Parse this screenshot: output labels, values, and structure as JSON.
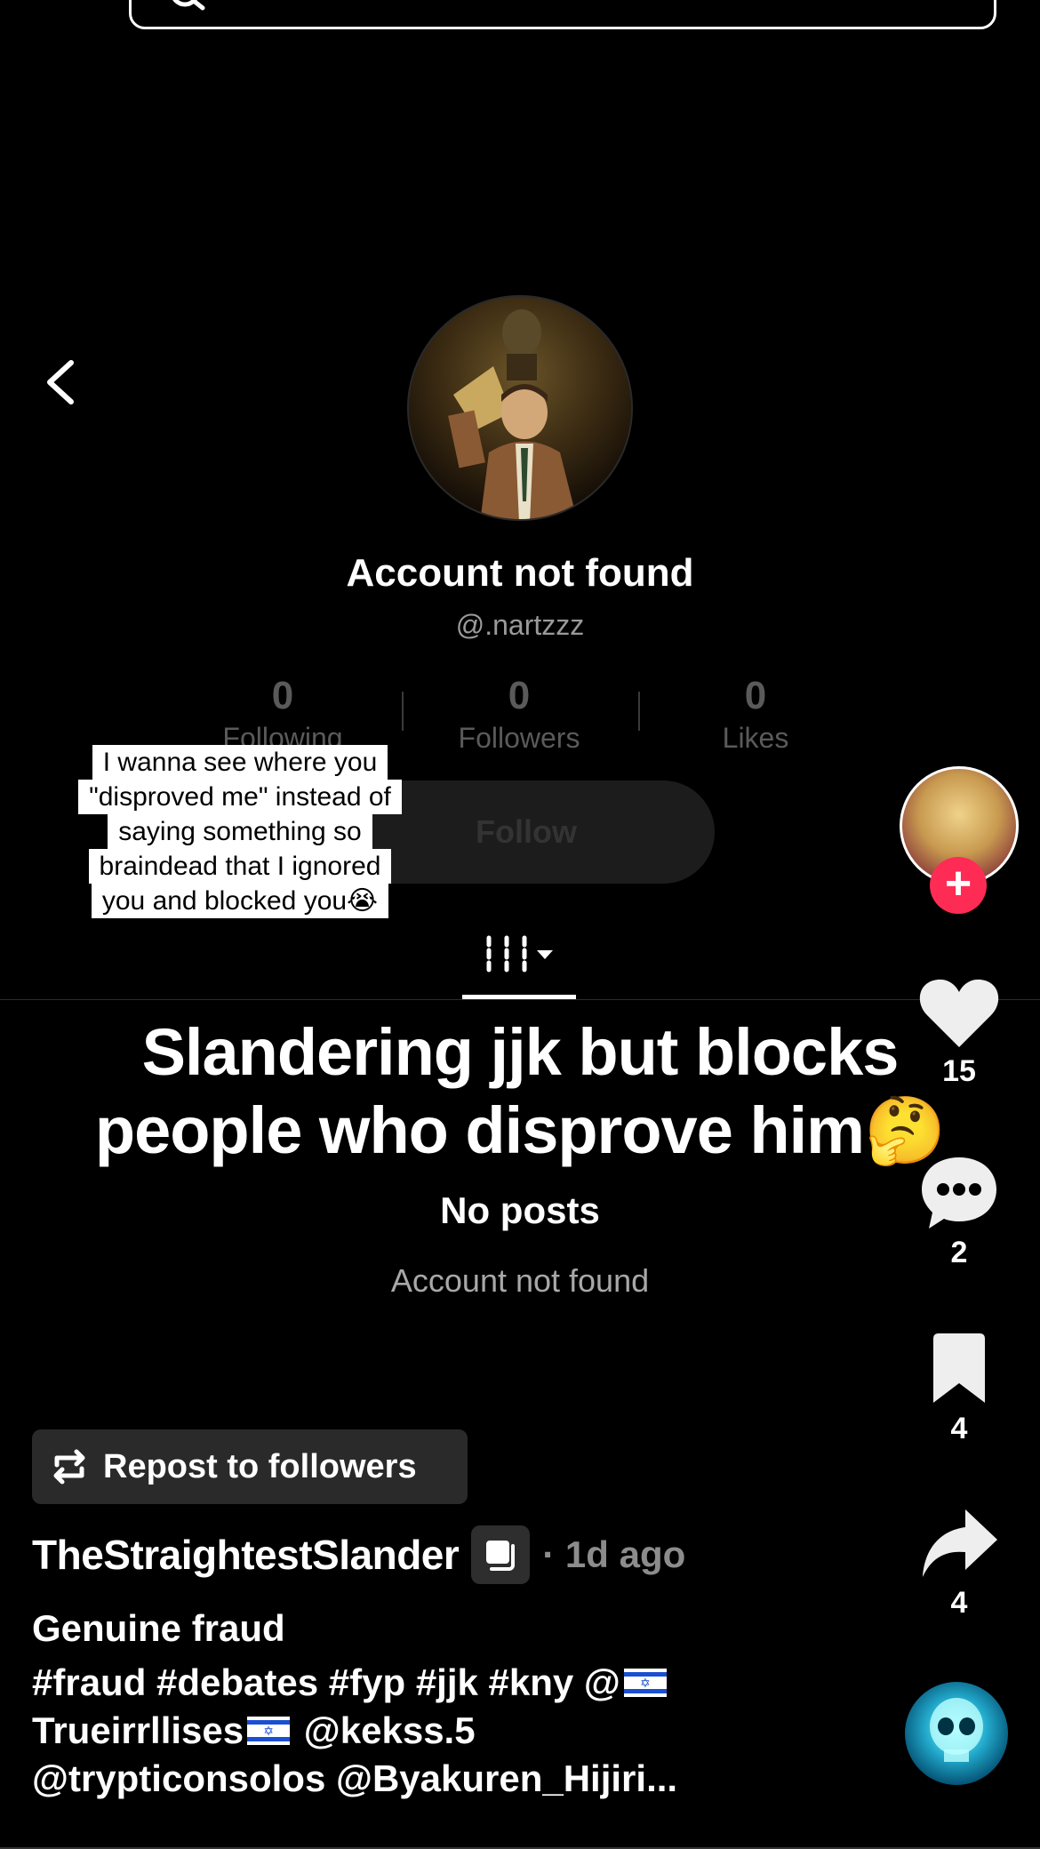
{
  "profile": {
    "name": "Account not found",
    "handle": "@.nartzzz",
    "stats": [
      {
        "value": "0",
        "label": "Following"
      },
      {
        "value": "0",
        "label": "Followers"
      },
      {
        "value": "0",
        "label": "Likes"
      }
    ],
    "follow_label": "Follow",
    "empty_title": "No posts",
    "empty_subtitle": "Account not found"
  },
  "comment_reply": {
    "lines": [
      "I wanna see where you",
      "\"disproved me\" instead of",
      "saying something so",
      "braindead that I ignored",
      "you and blocked you😭"
    ]
  },
  "video": {
    "caption_line1": "Slandering jjk but blocks",
    "caption_line2": "people who disprove him🤔"
  },
  "actions": {
    "likes": "15",
    "comments": "2",
    "saves": "4",
    "shares": "4"
  },
  "post": {
    "repost_label": "Repost to followers",
    "author": "TheStraightestSlander",
    "time": "· 1d ago",
    "description": "Genuine fraud",
    "tags_part1": "#fraud #debates #fyp #jjk #kny @",
    "tags_part2": "Trueirrllises",
    "tags_part3": " @kekss.5",
    "tags_part4": "@trypticonsolos @Byakuren_Hijiri..."
  },
  "colors": {
    "background": "#000000",
    "accent_red": "#fe2c55",
    "muted_text": "#9a9a9a"
  },
  "icons": [
    "back-icon",
    "search-icon",
    "grid-icon",
    "heart-icon",
    "comment-icon",
    "bookmark-icon",
    "share-icon",
    "repost-icon",
    "multi-image-icon"
  ]
}
